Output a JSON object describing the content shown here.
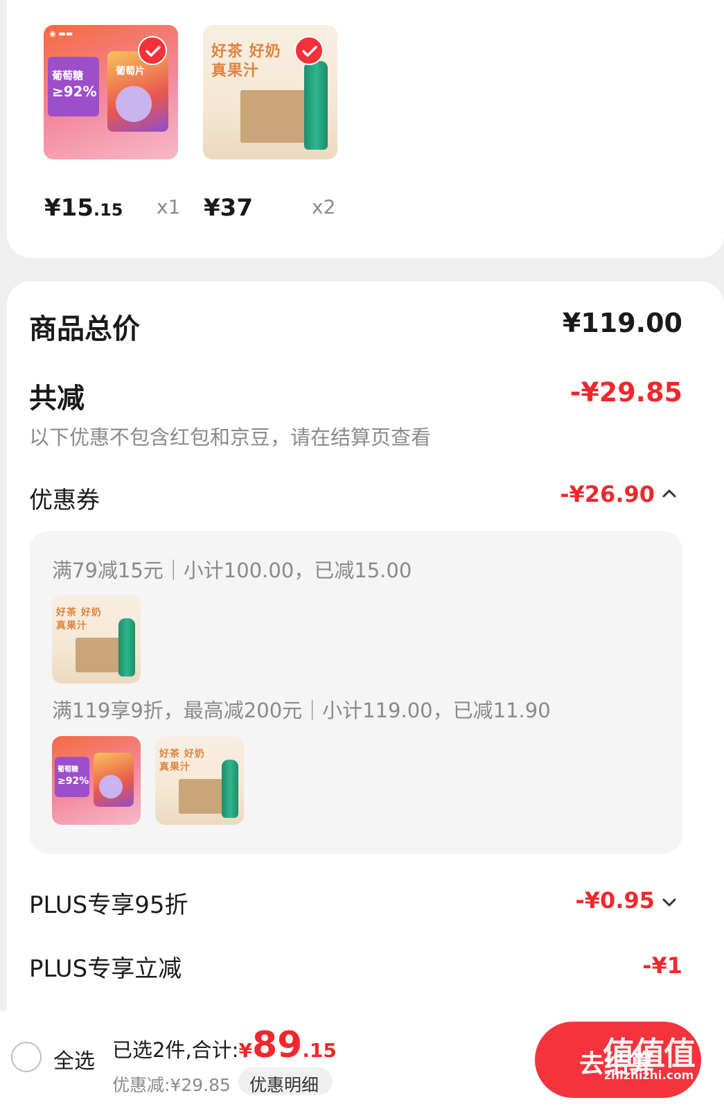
{
  "colors": {
    "accent_red": "#f0282d",
    "checkout_button": "#f5333d",
    "grey_text": "#8a8a8a"
  },
  "selected_products": [
    {
      "price_main": "¥15",
      "price_decimal": ".15",
      "qty": "x1",
      "thumb_lines": [
        "葡萄糖",
        "≥92%"
      ],
      "pack_label": "葡萄片",
      "checked": true
    },
    {
      "price_main": "¥37",
      "price_decimal": "",
      "qty": "x2",
      "thumb_lines": [
        "好茶 好奶",
        "真果汁"
      ],
      "checked": true
    }
  ],
  "summary": {
    "total_label": "商品总价",
    "total_value": "¥119.00",
    "discount_label": "共减",
    "discount_value": "-¥29.85",
    "notice": "以下优惠不包含红包和京豆，请在结算页查看"
  },
  "coupon": {
    "label": "优惠券",
    "value": "-¥26.90",
    "rules": [
      {
        "text": "满79减15元｜小计100.00，已减15.00"
      },
      {
        "text": "满119享9折，最高减200元｜小计119.00，已减11.90"
      }
    ]
  },
  "plus_discount": {
    "label": "PLUS专享95折",
    "value": "-¥0.95"
  },
  "plus_reduction": {
    "label": "PLUS专享立减",
    "value": "-¥1"
  },
  "bottom": {
    "select_all": "全选",
    "selected_prefix": "已选2件,合计:",
    "total_yen": "¥",
    "total_main": "89",
    "total_decimal": ".15",
    "discount_line": "优惠减:¥29.85",
    "detail_button": "优惠明细",
    "checkout": "去结算"
  },
  "watermark": {
    "main": "值值值",
    "sub": "zhizhizhi.com"
  }
}
